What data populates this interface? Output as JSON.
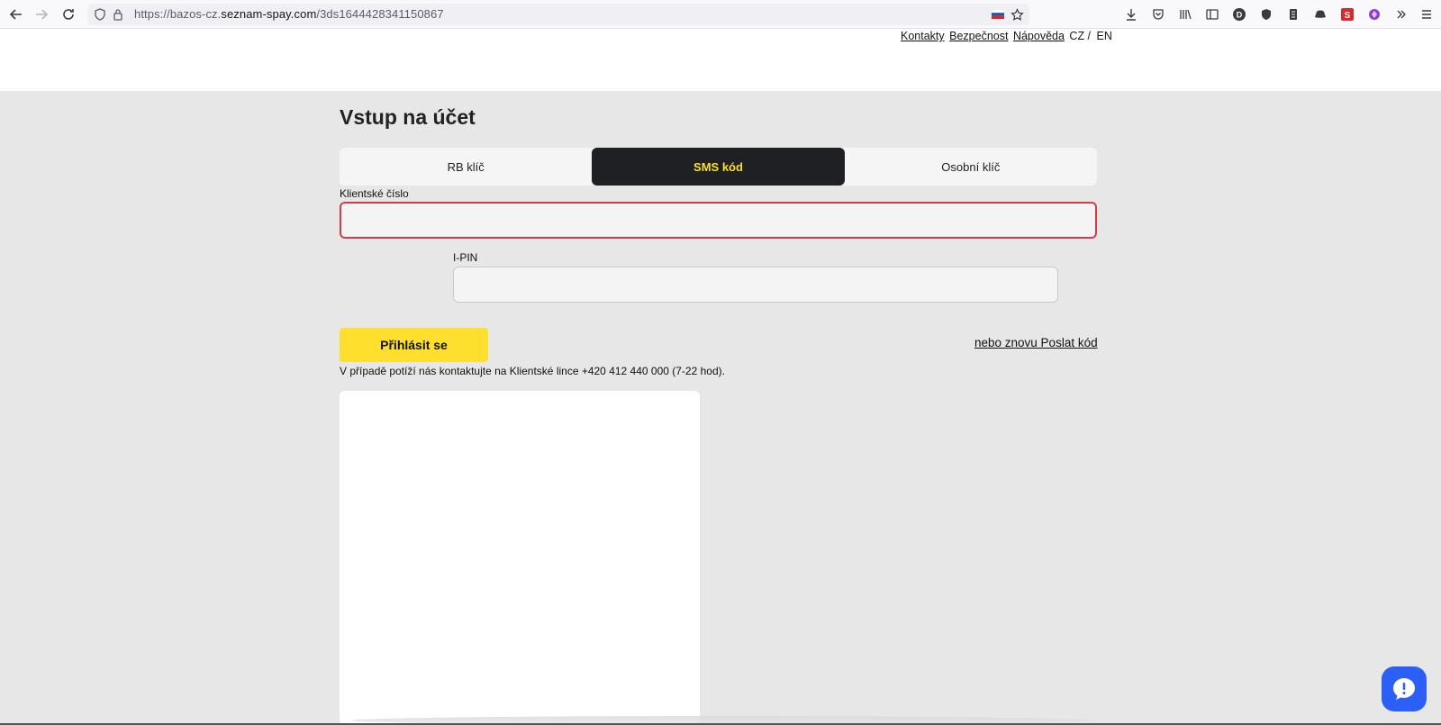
{
  "browser": {
    "url_prefix": "https://bazos-cz.",
    "url_host": "seznam-spay.com",
    "url_path": "/3ds1644428341150867"
  },
  "top_links": {
    "contacts": "Kontakty",
    "security": "Bezpečnost",
    "help": "Nápověda",
    "lang_cz": "CZ /",
    "lang_en": "EN"
  },
  "page": {
    "title": "Vstup na účet"
  },
  "tabs": [
    {
      "label": "RB klíč",
      "active": false
    },
    {
      "label": "SMS kód",
      "active": true
    },
    {
      "label": "Osobní klíč",
      "active": false
    }
  ],
  "form": {
    "client_number_label": "Klientské číslo",
    "client_number_value": "",
    "ipin_label": "I-PIN",
    "ipin_value": "",
    "login_button": "Přihlásit se",
    "resend_link": "nebo znovu Poslat kód",
    "help_text": "V případě potíží nás kontaktujte na Klientské lince +420 412 440 000 (7-22 hod)."
  },
  "colors": {
    "accent_yellow": "#ffdf2e",
    "active_tab_bg": "#1f2023",
    "error_border": "#d53c45",
    "chat_blue": "#2c5ff6"
  }
}
